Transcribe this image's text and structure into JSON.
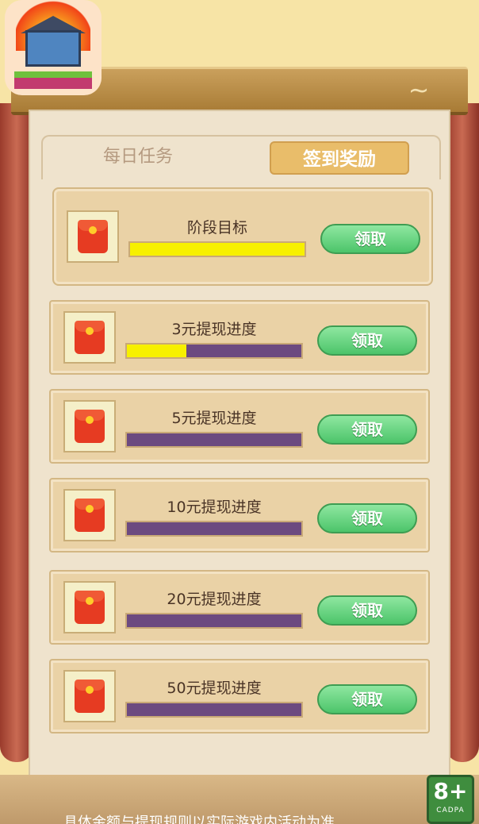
{
  "tabs": {
    "daily": "每日任务",
    "signin": "签到奖励"
  },
  "cards": [
    {
      "title": "阶段目标",
      "progress": 1.0,
      "button": "领取"
    },
    {
      "title": "3元提现进度",
      "progress": 0.34,
      "button": "领取"
    },
    {
      "title": "5元提现进度",
      "progress": 0.0,
      "button": "领取"
    },
    {
      "title": "10元提现进度",
      "progress": 0.0,
      "button": "领取"
    },
    {
      "title": "20元提现进度",
      "progress": 0.0,
      "button": "领取"
    },
    {
      "title": "50元提现进度",
      "progress": 0.0,
      "button": "领取"
    }
  ],
  "footer": {
    "note": "具体金额与提现规则以实际游戏内活动为准"
  },
  "age_rating": {
    "value": "8+",
    "label": "CADPA"
  },
  "colors": {
    "progress_fill": "#f7f000",
    "progress_track": "#6c4a80",
    "claim_button": "#4cc46a"
  }
}
